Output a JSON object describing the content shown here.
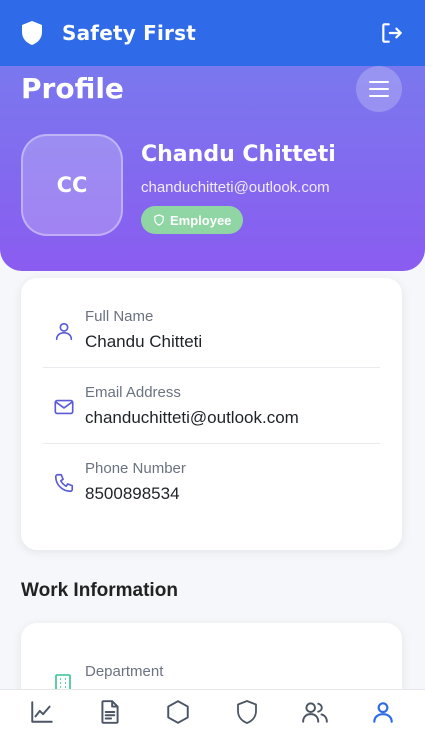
{
  "app": {
    "title": "Safety First"
  },
  "header": {
    "page_title": "Profile"
  },
  "profile": {
    "initials": "CC",
    "name": "Chandu Chitteti",
    "email": "chanduchitteti@outlook.com",
    "role_badge": "Employee"
  },
  "personal_info": {
    "rows": [
      {
        "label": "Full Name",
        "value": "Chandu Chitteti",
        "icon": "user-icon"
      },
      {
        "label": "Email Address",
        "value": "chanduchitteti@outlook.com",
        "icon": "mail-icon"
      },
      {
        "label": "Phone Number",
        "value": "8500898534",
        "icon": "phone-icon"
      }
    ]
  },
  "work_info": {
    "title": "Work Information",
    "rows": [
      {
        "label": "Department",
        "icon": "building-icon"
      }
    ]
  },
  "bottom_nav": {
    "items": [
      {
        "icon": "chart-icon",
        "active": false
      },
      {
        "icon": "document-icon",
        "active": false
      },
      {
        "icon": "hexagon-icon",
        "active": false
      },
      {
        "icon": "shield-icon",
        "active": false
      },
      {
        "icon": "users-icon",
        "active": false
      },
      {
        "icon": "user-icon",
        "active": true
      }
    ]
  },
  "colors": {
    "topbar": "#2f6be8",
    "hero_start": "#7a78ee",
    "hero_end": "#8a5cf0",
    "badge": "#8fd6a4",
    "icon_accent": "#5b5bd6",
    "nav_active": "#2f6be8",
    "nav_inactive": "#4b5563"
  }
}
